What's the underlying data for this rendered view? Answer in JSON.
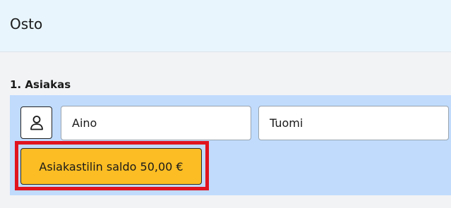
{
  "header": {
    "title": "Osto"
  },
  "customer_section": {
    "title": "1. Asiakas",
    "person_icon": "person-icon",
    "first_name": "Aino",
    "last_name": "Tuomi",
    "balance_button_label": "Asiakastilin saldo 50,00 €",
    "highlight_color": "#e0141e",
    "balance_button_color": "#fbbd23",
    "panel_color": "#c0dbfc"
  }
}
